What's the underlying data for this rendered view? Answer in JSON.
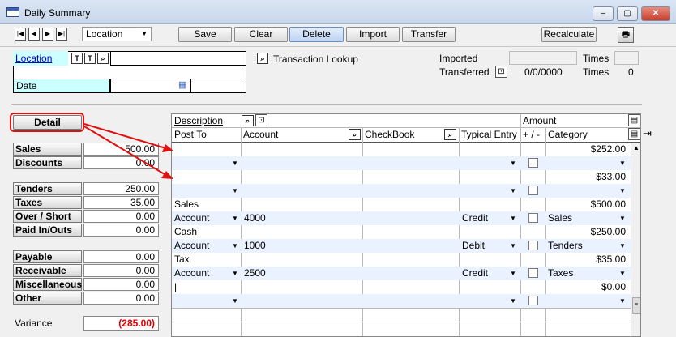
{
  "window": {
    "title": "Daily Summary",
    "minimize": "–",
    "maximize": "▢",
    "close": "✕"
  },
  "toolbar": {
    "nav": [
      "|◀",
      "◀",
      "▶",
      "▶|"
    ],
    "location_select": "Location",
    "buttons": [
      "Save",
      "Clear",
      "Delete",
      "Import",
      "Transfer"
    ],
    "active_button": "Delete",
    "recalculate": "Recalculate",
    "print_icon": "printer-icon"
  },
  "header": {
    "location_label": "Location",
    "location_value": "",
    "date_label": "Date",
    "date_value": "",
    "transaction_lookup": "Transaction Lookup",
    "imported_label": "Imported",
    "imported_value": "",
    "transferred_label": "Transferred",
    "transferred_date": "0/0/0000",
    "times_label_1": "Times",
    "times_value_1": "",
    "times_label_2": "Times",
    "times_value_2": "0"
  },
  "left_panel": {
    "detail_button": "Detail",
    "rows": [
      {
        "label": "Sales",
        "value": "500.00"
      },
      {
        "label": "Discounts",
        "value": "0.00"
      },
      {
        "label": "Tenders",
        "value": "250.00"
      },
      {
        "label": "Taxes",
        "value": "35.00"
      },
      {
        "label": "Over / Short",
        "value": "0.00"
      },
      {
        "label": "Paid In/Outs",
        "value": "0.00"
      },
      {
        "label": "Payable",
        "value": "0.00"
      },
      {
        "label": "Receivable",
        "value": "0.00"
      },
      {
        "label": "Miscellaneous",
        "value": "0.00"
      },
      {
        "label": "Other",
        "value": "0.00"
      }
    ],
    "variance_label": "Variance",
    "variance_value": "(285.00)",
    "variance_color": "#e00000"
  },
  "grid": {
    "headers": {
      "description": "Description",
      "amount": "Amount",
      "post_to": "Post To",
      "account": "Account",
      "checkbook": "CheckBook",
      "typical_entry": "Typical Entry",
      "plus_minus": "+ / -",
      "category": "Category"
    },
    "groups": [
      {
        "description": "",
        "amount": "$252.00",
        "post_to": "",
        "account": "",
        "typical_entry": "",
        "category": ""
      },
      {
        "description": "",
        "amount": "$33.00",
        "post_to": "",
        "account": "",
        "typical_entry": "",
        "category": ""
      },
      {
        "description": "Sales",
        "amount": "$500.00",
        "post_to": "Account",
        "account": "4000",
        "typical_entry": "Credit",
        "category": "Sales"
      },
      {
        "description": "Cash",
        "amount": "$250.00",
        "post_to": "Account",
        "account": "1000",
        "typical_entry": "Debit",
        "category": "Tenders"
      },
      {
        "description": "Tax",
        "amount": "$35.00",
        "post_to": "Account",
        "account": "2500",
        "typical_entry": "Credit",
        "category": "Taxes"
      },
      {
        "description": "|",
        "amount": "$0.00",
        "post_to": "",
        "account": "",
        "typical_entry": "",
        "category": ""
      }
    ]
  },
  "annotation_color": "#e01010"
}
